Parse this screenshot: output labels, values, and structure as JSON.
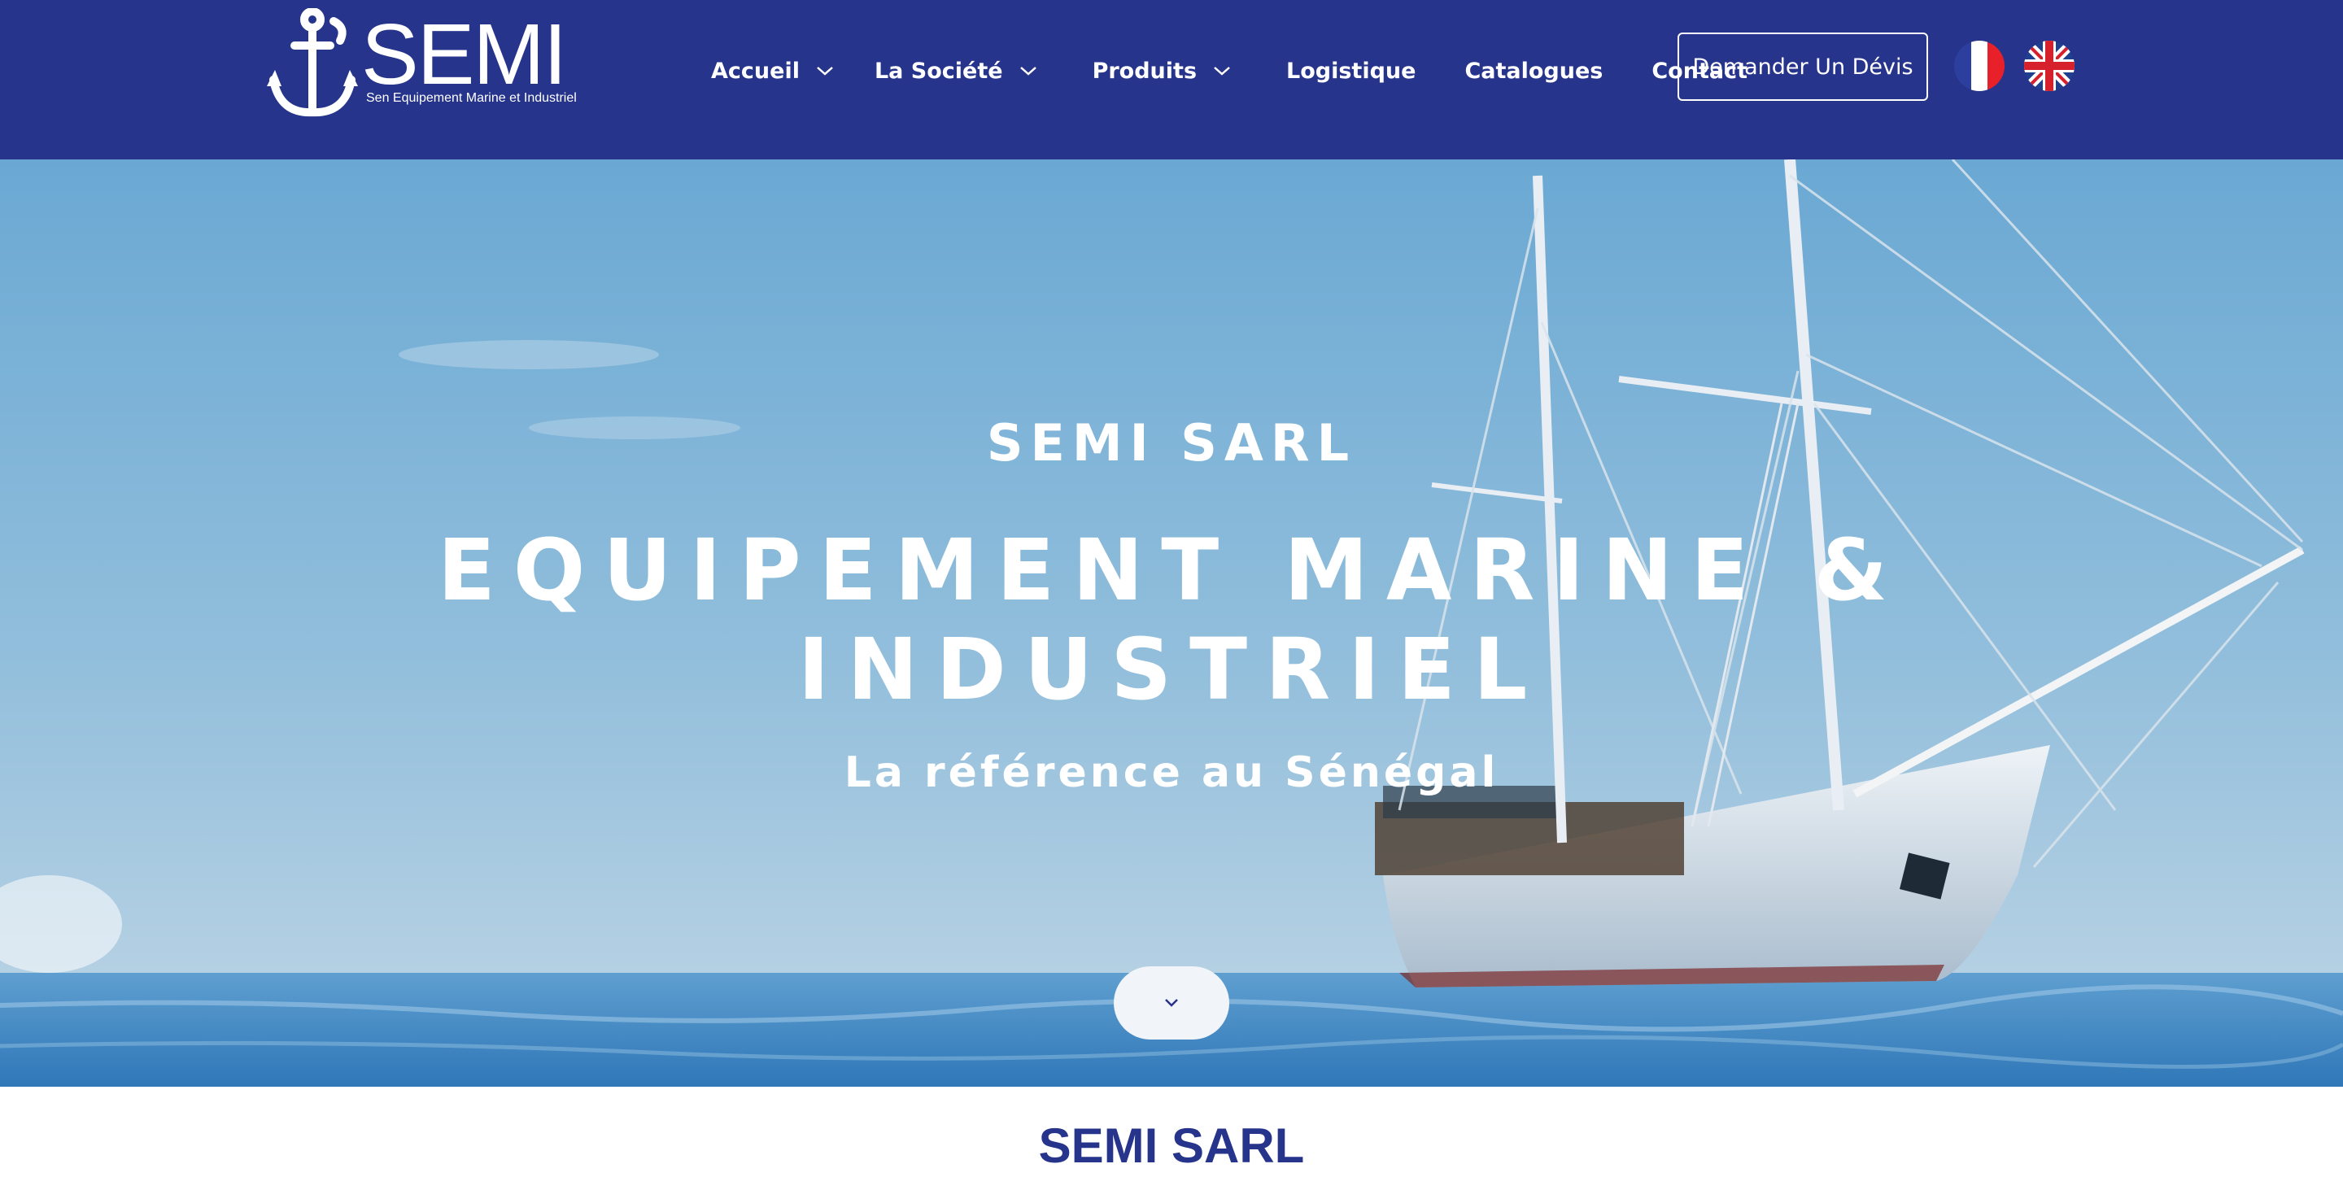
{
  "header": {
    "logo_text": "SEMI",
    "logo_tagline": "Sen Equipement Marine et Industriel",
    "nav": [
      {
        "label": "Accueil",
        "has_dropdown": true
      },
      {
        "label": "La Société",
        "has_dropdown": true
      },
      {
        "label": "Produits",
        "has_dropdown": true
      },
      {
        "label": "Logistique",
        "has_dropdown": false
      },
      {
        "label": "Catalogues",
        "has_dropdown": false
      },
      {
        "label": "Contact",
        "has_dropdown": false
      }
    ],
    "quote_button": "Demander Un Dévis",
    "languages": [
      "fr-flag-icon",
      "uk-flag-icon"
    ]
  },
  "hero": {
    "kicker": "SEMI SARL",
    "title": "EQUIPEMENT MARINE & INDUSTRIEL",
    "subtitle": "La référence au Sénégal",
    "scroll_icon": "chevron-down-icon"
  },
  "section": {
    "title": "SEMI SARL"
  },
  "colors": {
    "brand_blue": "#27348b",
    "sky_top": "#6aa9d4",
    "sea": "#3f86c2",
    "white": "#ffffff"
  }
}
